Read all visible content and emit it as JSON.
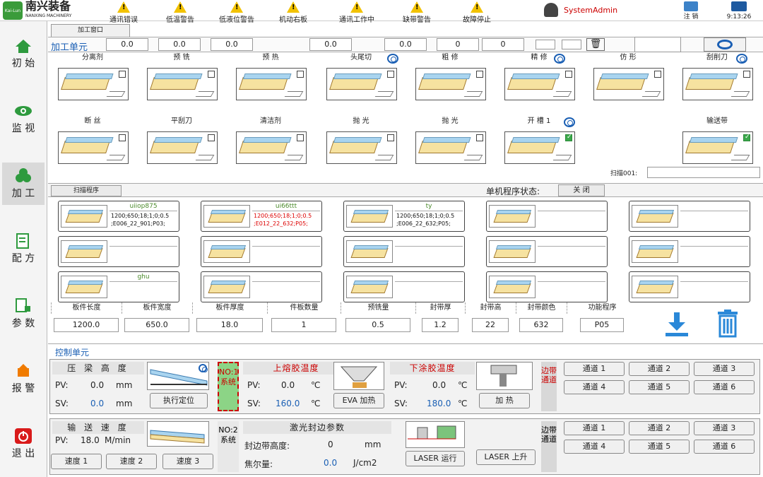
{
  "brand": {
    "logo_text": "Kai-Lun",
    "name": "南兴装备",
    "sub": "NANXING MACHINERY"
  },
  "alarms": [
    "通讯错误",
    "低温警告",
    "低液位警告",
    "机动右板",
    "通讯工作中",
    "缺带警告",
    "故障停止"
  ],
  "user": {
    "name": "SystemAdmin",
    "logout": "注 销",
    "time": "9:13:26"
  },
  "nav": [
    {
      "label": "初 始",
      "icon": "home-icon"
    },
    {
      "label": "监 视",
      "icon": "eye-icon"
    },
    {
      "label": "加 工",
      "icon": "process-icon"
    },
    {
      "label": "配 方",
      "icon": "recipe-icon"
    },
    {
      "label": "参 数",
      "icon": "params-icon"
    },
    {
      "label": "报 警",
      "icon": "alarm-icon"
    },
    {
      "label": "退 出",
      "icon": "power-icon"
    }
  ],
  "tab": "加工窗口",
  "unit": {
    "label": "加工单元",
    "values": [
      "0.0",
      "0.0",
      "0.0",
      "0.0",
      "0.0",
      "0",
      "0"
    ]
  },
  "stages_row1": [
    {
      "label": "分离剂",
      "checked": false
    },
    {
      "label": "预 铣",
      "checked": false
    },
    {
      "label": "预 热",
      "checked": false
    },
    {
      "label": "头尾切",
      "checked": false
    },
    {
      "label": "粗 修",
      "checked": false
    },
    {
      "label": "精 修",
      "checked": false
    },
    {
      "label": "仿 形",
      "checked": false
    },
    {
      "label": "刮削刀",
      "checked": false
    }
  ],
  "stages_row2": [
    {
      "label": "断 丝",
      "checked": false
    },
    {
      "label": "平刮刀",
      "checked": false
    },
    {
      "label": "清洁剂",
      "checked": false
    },
    {
      "label": "抛 光",
      "checked": false
    },
    {
      "label": "抛 光",
      "checked": false
    },
    {
      "label": "开 槽 1",
      "checked": true
    },
    {
      "label": "输送带",
      "checked": true
    }
  ],
  "scan_label": "扫描001:",
  "scan_prog_label": "扫描程序",
  "single_status_label": "单机程序状态:",
  "single_status_value": "关 闭",
  "programs": [
    {
      "name": "uiiop875",
      "detail": "1200;650;18;1;0;0.5 ;E006_22_901;P03;",
      "red": false
    },
    {
      "name": "ui66ttt",
      "detail": "1200;650;18;1;0;0.5 ;E012_22_632;P05;",
      "red": true
    },
    {
      "name": "ty",
      "detail": "1200;650;18;1;0;0.5 ;E006_22_632;P05;",
      "red": false
    },
    {
      "name": "",
      "detail": "",
      "red": false
    },
    {
      "name": "",
      "detail": "",
      "red": false
    },
    {
      "name": "",
      "detail": "",
      "red": false
    },
    {
      "name": "",
      "detail": "",
      "red": false
    },
    {
      "name": "",
      "detail": "",
      "red": false
    },
    {
      "name": "",
      "detail": "",
      "red": false
    },
    {
      "name": "",
      "detail": "",
      "red": false
    },
    {
      "name": "ghu",
      "detail": "",
      "red": false
    },
    {
      "name": "",
      "detail": "",
      "red": false
    },
    {
      "name": "",
      "detail": "",
      "red": false
    },
    {
      "name": "",
      "detail": "",
      "red": false
    },
    {
      "name": "",
      "detail": "",
      "red": false
    }
  ],
  "params": {
    "headers": [
      "板件长度",
      "板件宽度",
      "板件厚度",
      "件板数量",
      "预铣量",
      "封带厚",
      "封带高",
      "封带颜色",
      "功能程序"
    ],
    "values": [
      "1200.0",
      "650.0",
      "18.0",
      "1",
      "0.5",
      "1.2",
      "22",
      "632",
      "P05"
    ]
  },
  "control": {
    "title": "控制单元",
    "press": {
      "title": "压 梁 高 度",
      "pv_label": "PV:",
      "pv": "0.0",
      "sv_label": "SV:",
      "sv": "0.0",
      "unit": "mm",
      "btn": "执行定位"
    },
    "sys1": "NO:1 系统",
    "upper": {
      "title": "上熔胶温度",
      "pv_label": "PV:",
      "pv": "0.0",
      "sv_label": "SV:",
      "sv": "160.0",
      "unit": "℃",
      "btn": "EVA 加热"
    },
    "lower": {
      "title": "下涂胶温度",
      "pv_label": "PV:",
      "pv": "0.0",
      "sv_label": "SV:",
      "sv": "180.0",
      "unit": "℃",
      "btn": "加 热"
    },
    "edge_label": "边带通道",
    "channels": [
      "通道 1",
      "通道 2",
      "通道 3",
      "通道 4",
      "通道 5",
      "通道 6"
    ],
    "conveyor": {
      "title": "输 送 速 度",
      "pv_label": "PV:",
      "pv": "18.0",
      "unit": "M/min",
      "btns": [
        "速度 1",
        "速度 2",
        "速度 3"
      ]
    },
    "sys2": "NO:2 系统",
    "laser": {
      "title": "激光封边参数",
      "h_label": "封边带高度:",
      "h_val": "0",
      "h_unit": "mm",
      "j_label": "焦尔量:",
      "j_val": "0.0",
      "j_unit": "J/cm2",
      "run": "LASER 运行",
      "up": "LASER 上升"
    },
    "edge_label2": "边带通道",
    "channels2": [
      "通道 1",
      "通道 2",
      "通道 3",
      "通道 4",
      "通道 5",
      "通道 6"
    ]
  },
  "colors": {
    "accent": "#1a5fb4",
    "alarm": "#f2c200",
    "green": "#3aa84a",
    "red": "#cc0000"
  }
}
